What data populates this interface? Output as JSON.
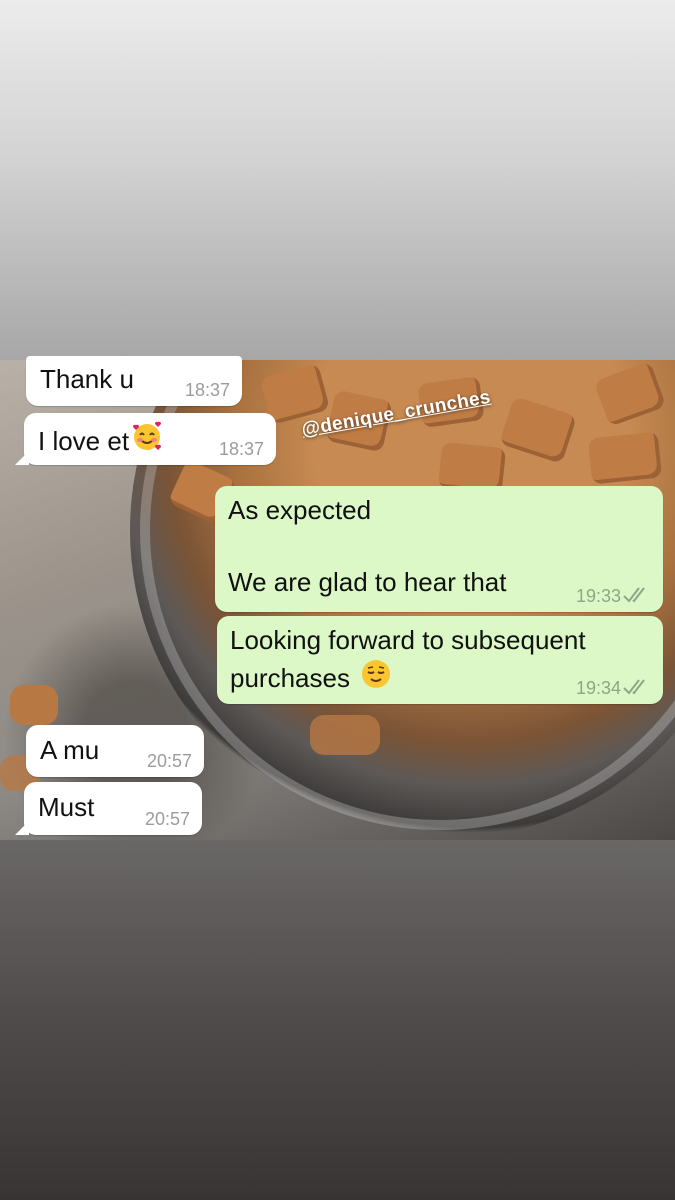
{
  "watermark": "@denique_crunches",
  "messages": [
    {
      "text": "Thank u",
      "time": "18:37",
      "direction": "incoming"
    },
    {
      "text": "I love et",
      "emoji": "smiling-face-with-hearts",
      "time": "18:37",
      "direction": "incoming"
    },
    {
      "text": "As expected\n\nWe are glad to hear that",
      "time": "19:33",
      "direction": "outgoing",
      "status": "read-double-check"
    },
    {
      "text": "Looking forward to subsequent\npurchases",
      "emoji": "relieved-face",
      "time": "19:34",
      "direction": "outgoing",
      "status": "read-double-check"
    },
    {
      "text": "A mu",
      "time": "20:57",
      "direction": "incoming"
    },
    {
      "text": "Must",
      "time": "20:57",
      "direction": "incoming"
    }
  ],
  "colors": {
    "incoming_bubble": "#ffffff",
    "outgoing_bubble": "#dcf8c6",
    "timestamp": "#9c9c9c"
  }
}
